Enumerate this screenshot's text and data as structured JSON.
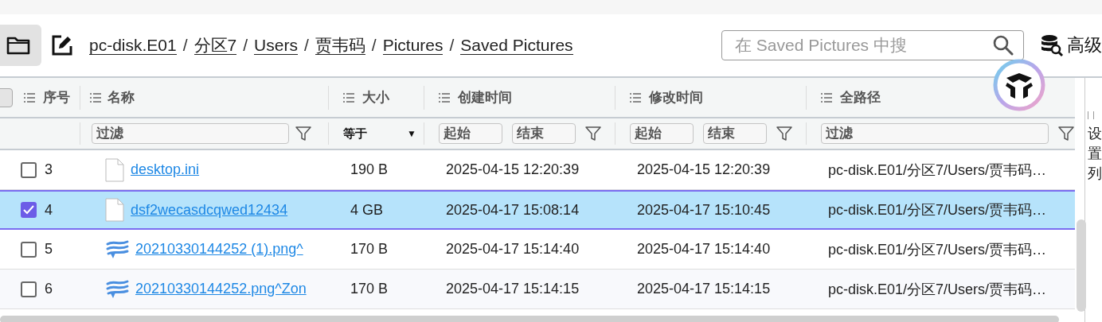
{
  "toolbar": {
    "breadcrumb": [
      "pc-disk.E01",
      "分区7",
      "Users",
      "贾韦码",
      "Pictures",
      "Saved Pictures"
    ],
    "separator": "/",
    "search": {
      "placeholder": "在 Saved Pictures 中搜"
    },
    "advanced_button": "高级"
  },
  "table": {
    "header_checked": false,
    "columns": [
      {
        "label": "序号"
      },
      {
        "label": "名称"
      },
      {
        "label": "大小"
      },
      {
        "label": "创建时间"
      },
      {
        "label": "修改时间"
      },
      {
        "label": "全路径"
      }
    ],
    "filters": {
      "name": {
        "placeholder": "过滤"
      },
      "size": {
        "value": "等于",
        "caret": "▼"
      },
      "created": {
        "from": {
          "placeholder": "起始"
        },
        "to": {
          "placeholder": "结束"
        }
      },
      "modified": {
        "from": {
          "placeholder": "起始"
        },
        "to": {
          "placeholder": "结束"
        }
      },
      "path": {
        "placeholder": "过滤"
      }
    },
    "rows": [
      {
        "checked": false,
        "selected": false,
        "number": "3",
        "kind": "file",
        "name": "desktop.ini",
        "size": "190 B",
        "created": "2025-04-15 12:20:39",
        "modified": "2025-04-15 12:20:39",
        "path": "pc-disk.E01/分区7/Users/贾韦码…"
      },
      {
        "checked": true,
        "selected": true,
        "number": "4",
        "kind": "file",
        "name": "dsf2wecasdcqwed12434",
        "size": "4 GB",
        "created": "2025-04-17 15:08:14",
        "modified": "2025-04-17 15:10:45",
        "path": "pc-disk.E01/分区7/Users/贾韦码…"
      },
      {
        "checked": false,
        "selected": false,
        "number": "5",
        "kind": "image",
        "name": "20210330144252 (1).png^",
        "size": "170 B",
        "created": "2025-04-17 15:14:40",
        "modified": "2025-04-17 15:14:40",
        "path": "pc-disk.E01/分区7/Users/贾韦码…"
      },
      {
        "checked": false,
        "selected": false,
        "number": "6",
        "kind": "image",
        "name": "20210330144252.png^Zon",
        "size": "170 B",
        "created": "2025-04-17 15:14:15",
        "modified": "2025-04-17 15:14:15",
        "path": "pc-disk.E01/分区7/Users/贾韦码…"
      }
    ]
  },
  "side_panel": {
    "label": "设置列"
  }
}
